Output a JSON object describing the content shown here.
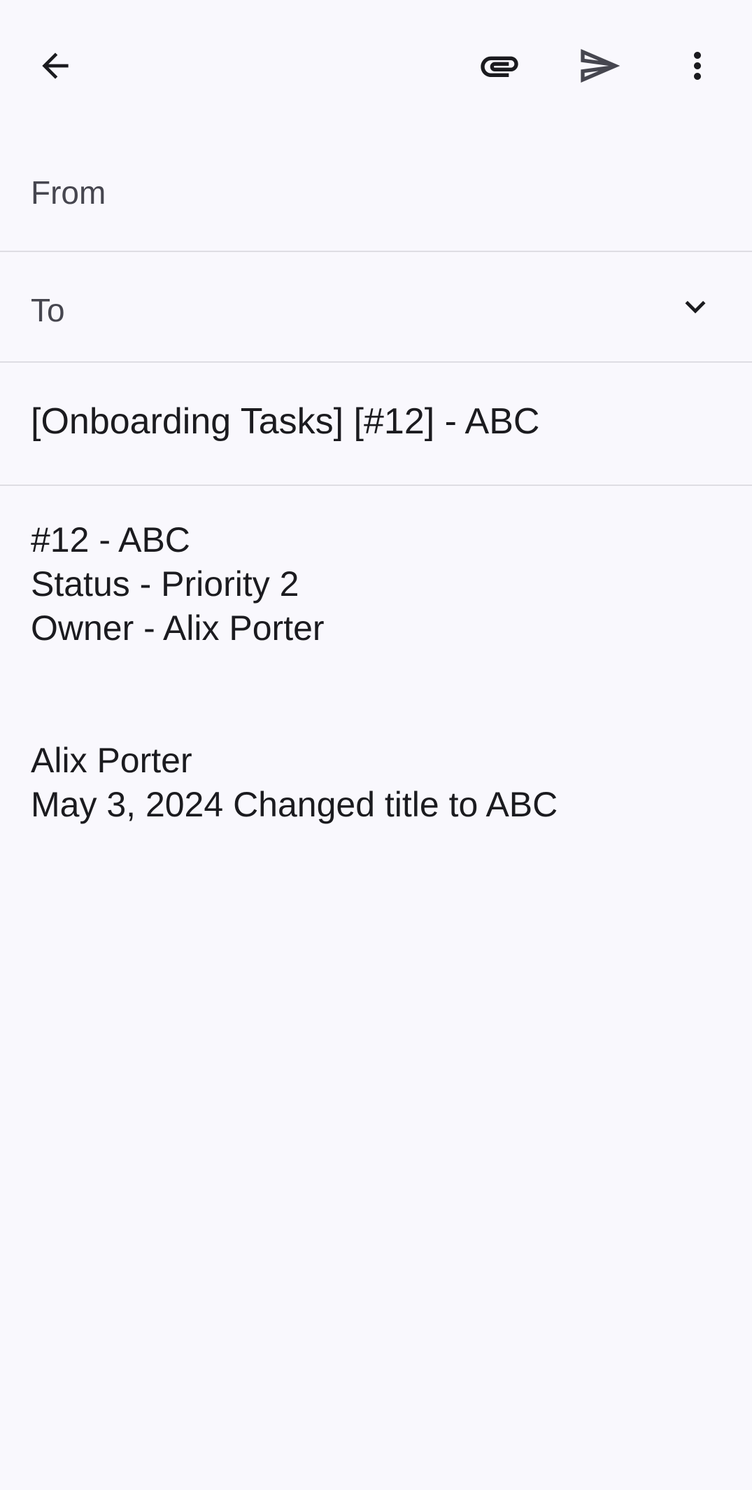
{
  "toolbar": {
    "back_icon": "arrow-left-icon",
    "attach_icon": "paperclip-icon",
    "send_icon": "send-icon",
    "more_icon": "more-vert-icon"
  },
  "compose": {
    "from_label": "From",
    "to_label": "To",
    "to_value": "",
    "subject": "[Onboarding Tasks] [#12] - ABC"
  },
  "body": {
    "block1": [
      "#12 - ABC",
      "Status - Priority 2",
      "Owner - Alix Porter"
    ],
    "block2": [
      "Alix Porter",
      "May 3, 2024 Changed title to ABC"
    ]
  },
  "colors": {
    "background": "#f9f8fd",
    "divider": "#dedde3",
    "icon": "#1b1b1f",
    "label": "#46464f"
  }
}
